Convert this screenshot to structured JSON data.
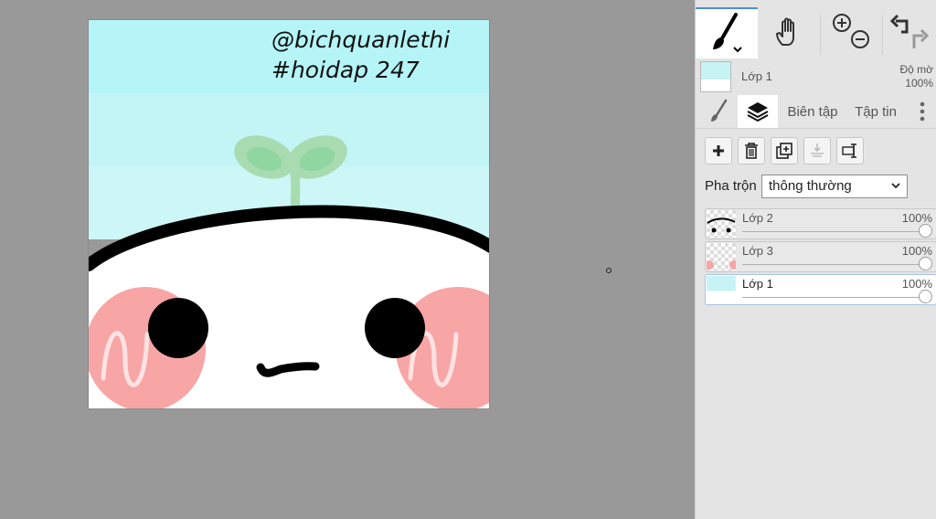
{
  "canvas": {
    "watermark_line1": "@bichquanlethi",
    "watermark_line2": "#hoidap 247"
  },
  "toolbar": {
    "brush_icon": "brush-icon",
    "hand_icon": "hand-icon",
    "zoom_in_icon": "zoom-in-icon",
    "zoom_out_icon": "zoom-out-icon",
    "undo_icon": "undo-icon",
    "redo_icon": "redo-icon"
  },
  "current_layer": {
    "name": "Lớp 1",
    "opacity_label": "Độ mờ",
    "opacity_value": "100%"
  },
  "tabs": {
    "edit": "Biên tập",
    "file": "Tập tin"
  },
  "blend": {
    "label": "Pha trộn",
    "value": "thông thường"
  },
  "layers": [
    {
      "name": "Lớp 2",
      "opacity": "100%",
      "opacity_fraction": 1.0
    },
    {
      "name": "Lớp 3",
      "opacity": "100%",
      "opacity_fraction": 1.0
    },
    {
      "name": "Lớp 1",
      "opacity": "100%",
      "opacity_fraction": 1.0,
      "active": true
    }
  ],
  "colors": {
    "accent": "#4a90d9",
    "sky": "#c7f3f5",
    "cheek": "#f8a5a5",
    "sprout": "#a8dcb0"
  }
}
